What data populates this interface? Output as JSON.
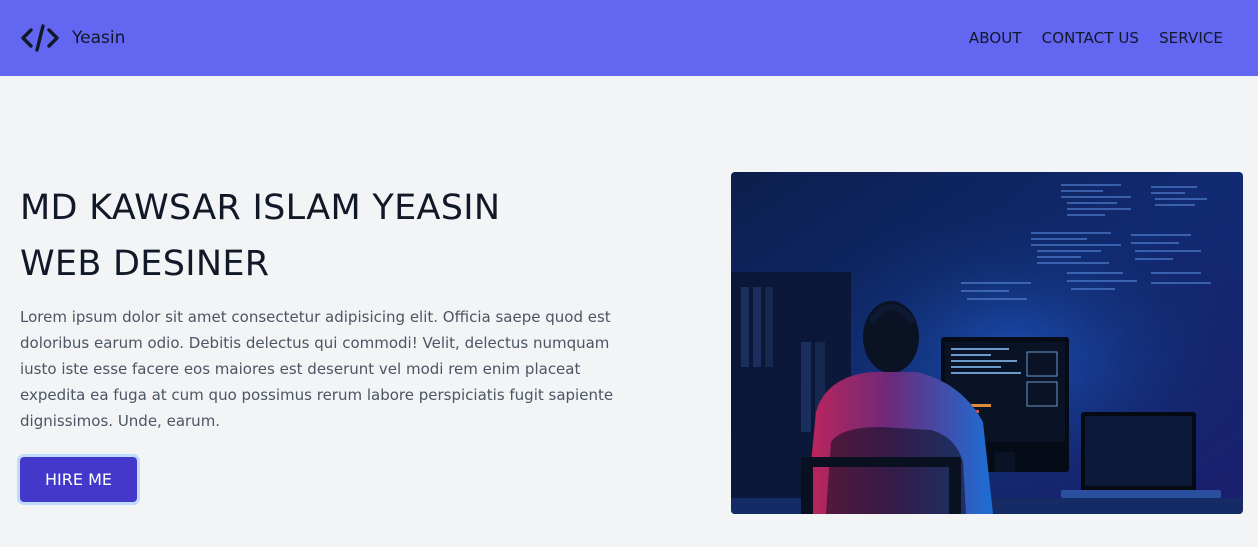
{
  "navbar": {
    "brand_name": "Yeasin",
    "links": [
      "ABOUT",
      "CONTACT US",
      "SERVICE"
    ]
  },
  "hero": {
    "title_line1": "MD KAWSAR ISLAM YEASIN",
    "title_line2": "WEB DESINER",
    "description": "Lorem ipsum dolor sit amet consectetur adipisicing elit. Officia saepe quod est doloribus earum odio. Debitis delectus qui commodi! Velit, delectus numquam iusto iste esse facere eos maiores est deserunt vel modi rem enim placeat expedita ea fuga at cum quo possimus rerum labore perspiciatis fugit sapiente dignissimos. Unde, earum.",
    "button_label": "HIRE ME"
  },
  "colors": {
    "nav_bg": "#6366f1",
    "page_bg": "#f3f4f6",
    "button_bg": "#4338ca",
    "button_ring": "#bfdbfe"
  },
  "icons": {
    "brand": "code-icon"
  }
}
